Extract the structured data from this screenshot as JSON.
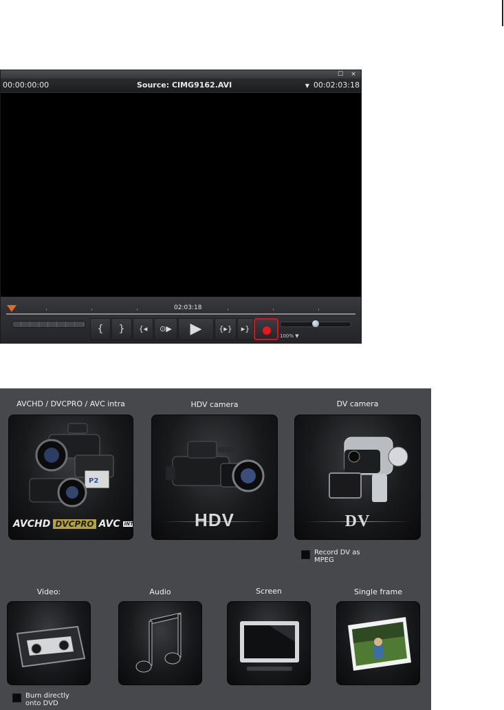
{
  "player": {
    "timecode_start": "00:00:00:00",
    "source_label": "Source: CIMG9162.AVI",
    "timecode_end": "00:02:03:18",
    "position_timecode": "02:03:18",
    "zoom_label": "100%",
    "window_buttons": {
      "maximize": "☐",
      "close": "×"
    },
    "controls": {
      "mark_in": "{",
      "mark_out": "}",
      "prev": "{◂",
      "loop": "⊙▶",
      "play": "▶",
      "next": "{▸}",
      "end": "▸}"
    },
    "record_color": "#f1131b"
  },
  "capture": {
    "sources": [
      {
        "label": "AVCHD / DVCPRO / AVC intra",
        "brand": [
          "AVCHD",
          "DVCPRO",
          "AVC",
          "INTRA"
        ]
      },
      {
        "label": "HDV camera",
        "brand": "HDV"
      },
      {
        "label": "DV camera",
        "brand": "DV"
      }
    ],
    "dv_option": "Record DV as MPEG",
    "other_sources": [
      {
        "label": "Video:"
      },
      {
        "label": "Audio"
      },
      {
        "label": "Screen"
      },
      {
        "label": "Single frame"
      }
    ],
    "video_option": "Burn directly onto DVD"
  }
}
